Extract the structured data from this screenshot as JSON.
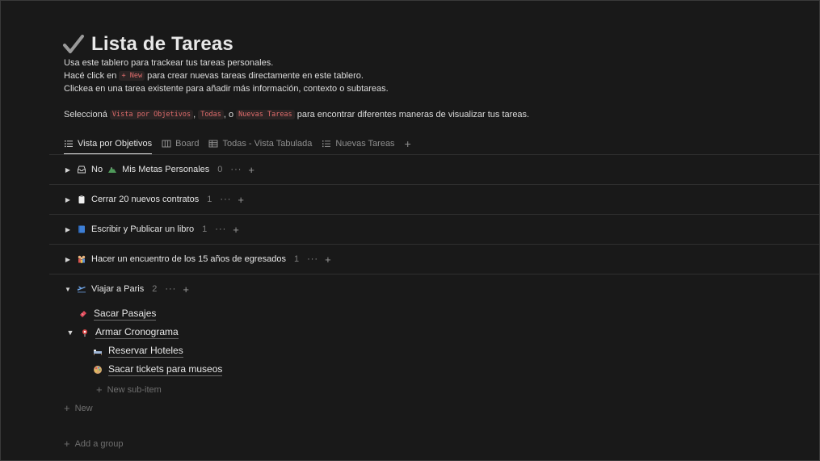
{
  "page": {
    "title": "Lista de Tareas",
    "desc1": "Usa este tablero para trackear tus tareas personales.",
    "desc2_pre": "Hacé click en",
    "desc2_code": "+ New",
    "desc2_post": "para crear nuevas tareas directamente en este tablero.",
    "desc3": "Clickea en una tarea existente para añadir más información, contexto o subtareas.",
    "desc4_pre": "Seleccioná",
    "desc4_code1": "Vista por Objetivos",
    "desc4_sep1": ",",
    "desc4_code2": "Todas",
    "desc4_sep2": ", o",
    "desc4_code3": "Nuevas Tareas",
    "desc4_post": "para encontrar diferentes maneras de visualizar tus tareas."
  },
  "tabs": [
    {
      "label": "Vista por Objetivos",
      "icon": "list-icon",
      "active": true
    },
    {
      "label": "Board",
      "icon": "board-icon"
    },
    {
      "label": "Todas - Vista Tabulada",
      "icon": "table-icon"
    },
    {
      "label": "Nuevas Tareas",
      "icon": "list-icon"
    }
  ],
  "groups": [
    {
      "prefix": "No",
      "label": "Mis Metas Personales",
      "count": "0",
      "icon": "inbox-icon",
      "icon2": "mountain-icon",
      "more": "···",
      "plus": "+"
    },
    {
      "label": "Cerrar 20 nuevos contratos",
      "count": "1",
      "icon": "clipboard-icon",
      "more": "···",
      "plus": "+"
    },
    {
      "label": "Escribir y Publicar un libro",
      "count": "1",
      "icon": "book-icon",
      "more": "···",
      "plus": "+"
    },
    {
      "label": "Hacer un encuentro de los 15 años de egresados",
      "count": "1",
      "icon": "people-icon",
      "more": "···",
      "plus": "+"
    },
    {
      "label": "Viajar a Paris",
      "count": "2",
      "icon": "airplane-icon",
      "more": "···",
      "plus": "+"
    }
  ],
  "items": {
    "i1": "Sacar Pasajes",
    "i2": "Armar Cronograma",
    "i3": "Reservar Hoteles",
    "i4": "Sacar tickets para museos",
    "new_sub": "New sub-item",
    "new": "New",
    "add_group": "Add a group"
  },
  "colors": {
    "background": "#191919",
    "text": "#e6e6e6",
    "code_text": "#e06c6c",
    "muted": "#7f7f7f"
  }
}
